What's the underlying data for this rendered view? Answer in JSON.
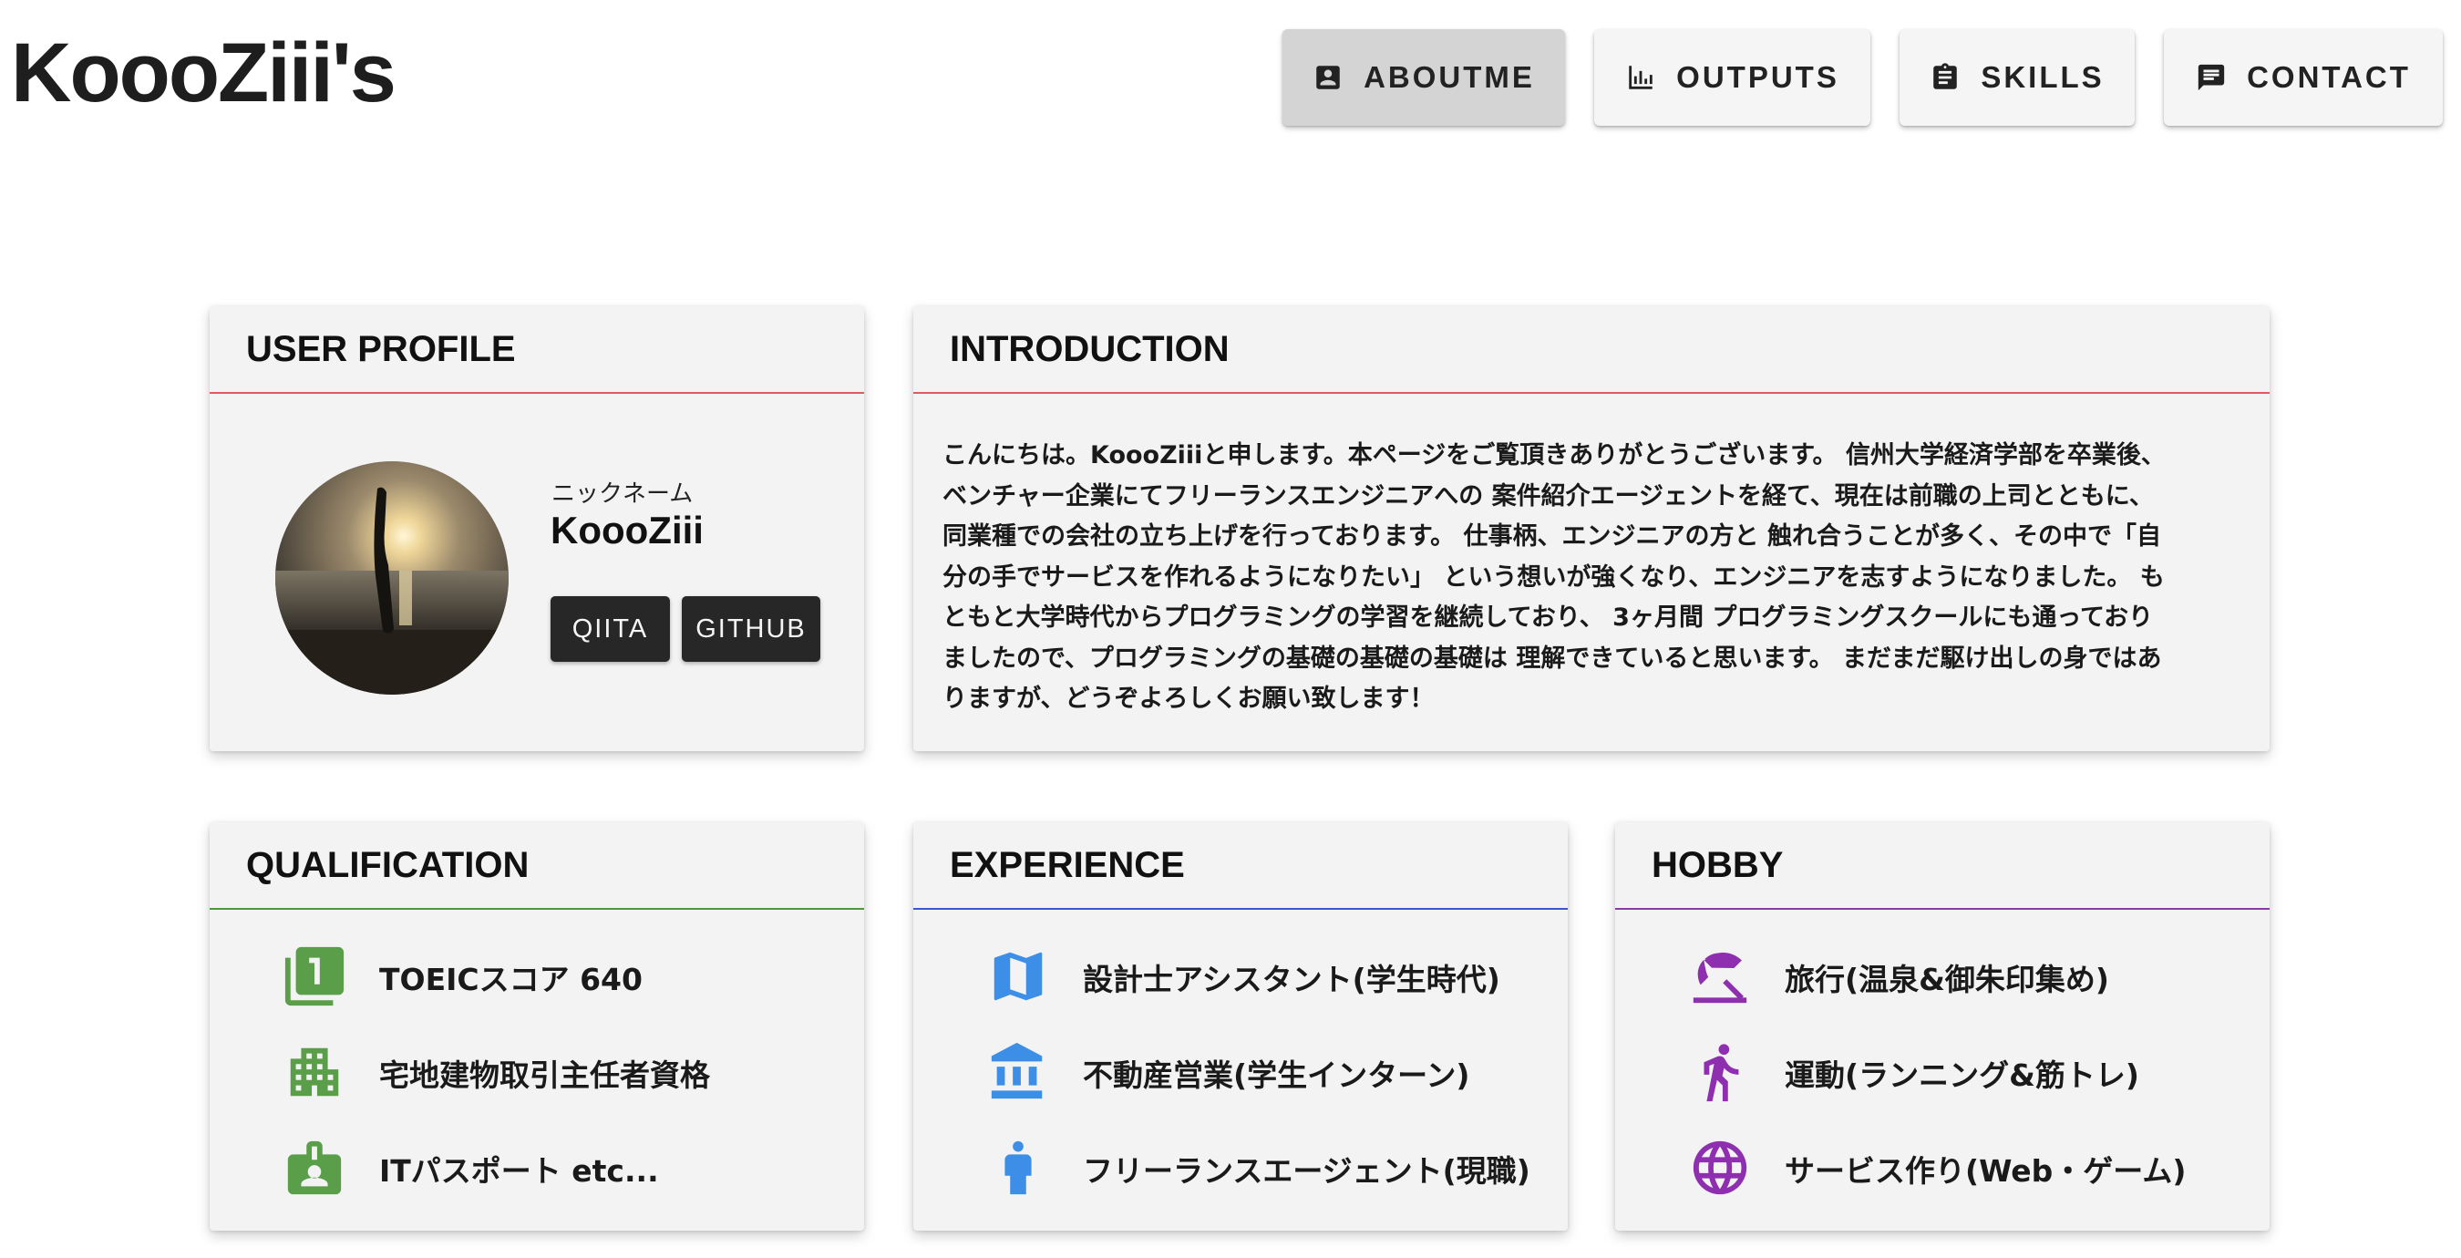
{
  "brand": "KoooZiii's",
  "nav": [
    {
      "label": "ABOUTME",
      "icon": "account-box-icon"
    },
    {
      "label": "OUTPUTS",
      "icon": "bar-chart-icon"
    },
    {
      "label": "SKILLS",
      "icon": "assignment-icon"
    },
    {
      "label": "CONTACT",
      "icon": "chat-icon"
    }
  ],
  "profile": {
    "title": "USER PROFILE",
    "nickname_label": "ニックネーム",
    "nickname": "KoooZiii",
    "buttons": [
      "QIITA",
      "GITHUB"
    ]
  },
  "introduction": {
    "title": "INTRODUCTION",
    "lines": [
      "こんにちは。KoooZiiiと申します。本ページをご覧頂きありがとうございます。 信州大学経済学部を卒業後、",
      "ベンチャー企業にてフリーランスエンジニアへの 案件紹介エージェントを経て、現在は前職の上司とともに、",
      "同業種での会社の立ち上げを行っております。 仕事柄、エンジニアの方と 触れ合うことが多く、その中で「自",
      "分の手でサービスを作れるようになりたい」 という想いが強くなり、エンジニアを志すようになりました。 も",
      "ともと大学時代からプログラミングの学習を継続しており、 3ヶ月間 プログラミングスクールにも通っており",
      "ましたので、プログラミングの基礎の基礎の基礎は 理解できていると思います。 まだまだ駆け出しの身ではあ",
      "りますが、どうぞよろしくお願い致します！"
    ]
  },
  "qualification": {
    "title": "QUALIFICATION",
    "color": "#5a9e4a",
    "items": [
      {
        "text": "TOEICスコア 640",
        "icon": "filter-1-icon"
      },
      {
        "text": "宅地建物取引主任者資格",
        "icon": "apartment-icon"
      },
      {
        "text": "ITパスポート etc...",
        "icon": "badge-icon"
      }
    ]
  },
  "experience": {
    "title": "EXPERIENCE",
    "color": "#3d8ee6",
    "items": [
      {
        "text": "設計士アシスタント(学生時代)",
        "icon": "map-icon"
      },
      {
        "text": "不動産営業(学生インターン)",
        "icon": "bank-icon"
      },
      {
        "text": "フリーランスエージェント(現職)",
        "icon": "person-icon"
      }
    ]
  },
  "hobby": {
    "title": "HOBBY",
    "color": "#8e2fb0",
    "items": [
      {
        "text": "旅行(温泉&御朱印集め)",
        "icon": "beach-icon"
      },
      {
        "text": "運動(ランニング&筋トレ)",
        "icon": "running-icon"
      },
      {
        "text": "サービス作り(Web・ゲーム)",
        "icon": "globe-icon"
      }
    ]
  }
}
